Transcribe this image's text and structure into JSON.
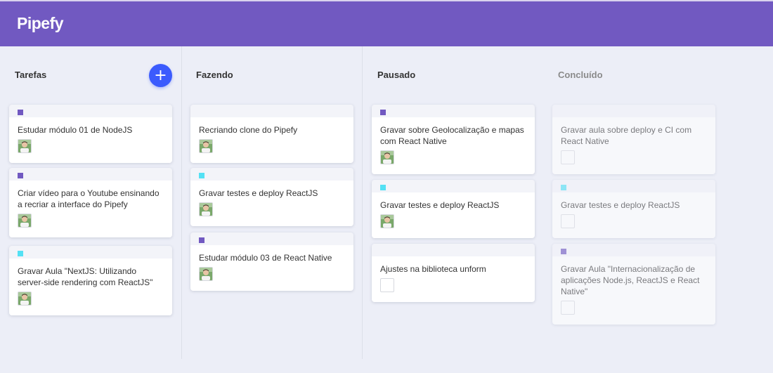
{
  "app": {
    "title": "Pipefy"
  },
  "colors": {
    "header": "#7159c1",
    "background": "#eceef7",
    "accent": "#3b5bfd",
    "label_purple": "#7159c1",
    "label_cyan": "#54e1f4"
  },
  "add_button": {
    "icon": "plus-icon",
    "label": "+"
  },
  "lists": [
    {
      "title": "Tarefas",
      "cards": [
        {
          "content": "Estudar módulo 01 de NodeJS",
          "label": "#7159c1",
          "avatar": "user-photo"
        },
        {
          "content": "Criar vídeo para o Youtube ensinando a recriar a interface do Pipefy",
          "label": "#7159c1",
          "avatar": "user-photo"
        },
        {
          "content": "Gravar Aula \"NextJS: Utilizando server-side rendering com ReactJS\"",
          "label": "#54e1f4",
          "avatar": "user-photo"
        }
      ]
    },
    {
      "title": "Fazendo",
      "cards": [
        {
          "content": "Recriando clone do Pipefy",
          "label": "",
          "avatar": "user-photo"
        },
        {
          "content": "Gravar testes e deploy ReactJS",
          "label": "#54e1f4",
          "avatar": "user-photo"
        },
        {
          "content": "Estudar módulo 03 de React Native",
          "label": "#7159c1",
          "avatar": "user-photo"
        }
      ]
    },
    {
      "title": "Pausado",
      "cards": [
        {
          "content": "Gravar sobre Geolocalização e mapas com React Native",
          "label": "#7159c1",
          "avatar": "user-photo"
        },
        {
          "content": "Gravar testes e deploy ReactJS",
          "label": "#54e1f4",
          "avatar": "user-photo"
        },
        {
          "content": "Ajustes na biblioteca unform",
          "label": "",
          "avatar": "empty"
        }
      ]
    },
    {
      "title": "Concluído",
      "cards": [
        {
          "content": "Gravar aula sobre deploy e CI com React Native",
          "label": "",
          "avatar": "empty"
        },
        {
          "content": "Gravar testes e deploy ReactJS",
          "label": "#54e1f4",
          "avatar": "empty"
        },
        {
          "content": "Gravar Aula \"Internacionalização de aplicações Node.js, ReactJS e React Native\"",
          "label": "#7159c1",
          "avatar": "empty"
        }
      ]
    }
  ]
}
